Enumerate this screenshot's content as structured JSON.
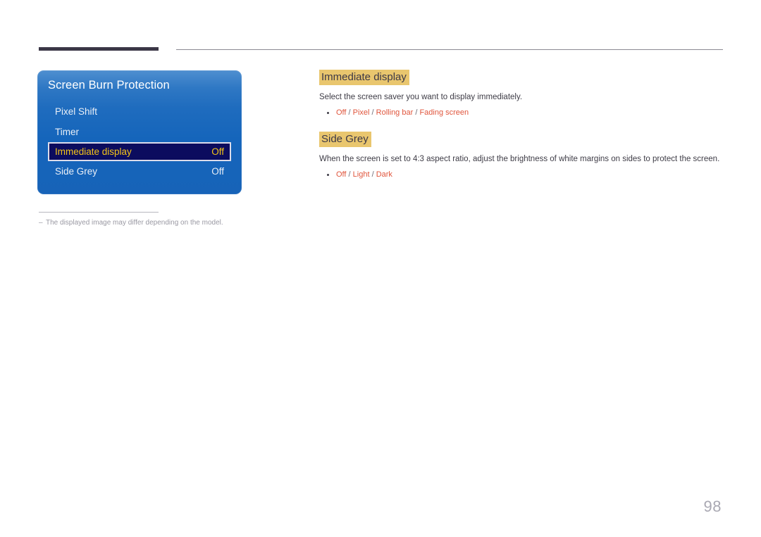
{
  "page": {
    "number": "98",
    "accent_highlight": "#e9c66e",
    "accent_option": "#e0553c",
    "osd_selected_text": "#f5c518"
  },
  "osd": {
    "title": "Screen Burn Protection",
    "items": [
      {
        "label": "Pixel Shift",
        "value": "",
        "selected": false
      },
      {
        "label": "Timer",
        "value": "",
        "selected": false
      },
      {
        "label": "Immediate display",
        "value": "Off",
        "selected": true
      },
      {
        "label": "Side Grey",
        "value": "Off",
        "selected": false
      }
    ]
  },
  "footnote": {
    "dash": "–",
    "text": "The displayed image may differ depending on the model."
  },
  "sections": [
    {
      "heading": "Immediate display",
      "description": "Select the screen saver you want to display immediately.",
      "options": [
        "Off",
        "Pixel",
        "Rolling bar",
        "Fading screen"
      ],
      "options_text": "Off / Pixel / Rolling bar / Fading screen"
    },
    {
      "heading": "Side Grey",
      "description": "When the screen is set to 4:3 aspect ratio, adjust the brightness of white margins on sides to protect the screen.",
      "options": [
        "Off",
        "Light",
        "Dark"
      ],
      "options_text": "Off / Light / Dark"
    }
  ]
}
